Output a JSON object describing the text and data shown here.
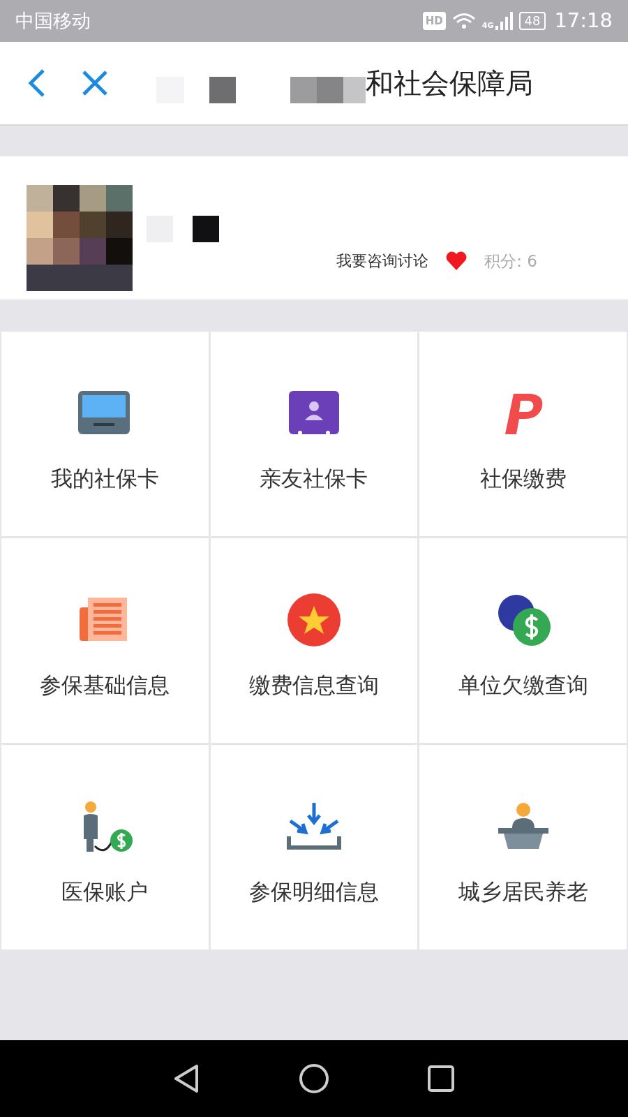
{
  "status_bar": {
    "carrier": "中国移动",
    "hd": "HD",
    "network": "4G",
    "battery": "48",
    "time": "17:18"
  },
  "header": {
    "title": "和社会保障局"
  },
  "profile": {
    "link": "我要咨询讨论",
    "liked": true,
    "points": "积分: 6"
  },
  "services": [
    {
      "label": "我的社保卡",
      "kind": "card"
    },
    {
      "label": "亲友社保卡",
      "kind": "contact"
    },
    {
      "label": "社保缴费",
      "kind": "plogo"
    },
    {
      "label": "参保基础信息",
      "kind": "newspaper"
    },
    {
      "label": "缴费信息查询",
      "kind": "star"
    },
    {
      "label": "单位欠缴查询",
      "kind": "coins"
    },
    {
      "label": "医保账户",
      "kind": "personmoney"
    },
    {
      "label": "参保明细信息",
      "kind": "inbox"
    },
    {
      "label": "城乡居民养老",
      "kind": "desk"
    }
  ]
}
